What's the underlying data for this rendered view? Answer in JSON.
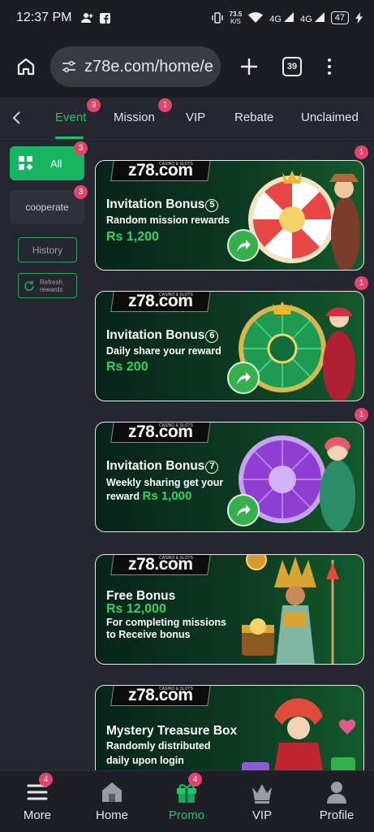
{
  "status_bar": {
    "time": "12:37 PM",
    "net_speed_value": "73.5",
    "net_speed_unit": "K/S",
    "signal1": "4G",
    "signal2": "4G",
    "battery": "47"
  },
  "browser": {
    "url": "z78e.com/home/e",
    "tab_count": "39"
  },
  "tabs": [
    {
      "label": "Event",
      "badge": "3",
      "active": true
    },
    {
      "label": "Mission",
      "badge": "1",
      "active": false
    },
    {
      "label": "VIP",
      "badge": "",
      "active": false
    },
    {
      "label": "Rebate",
      "badge": "",
      "active": false
    },
    {
      "label": "Unclaimed",
      "badge": "",
      "active": false
    }
  ],
  "sidebar": {
    "all_label": "All",
    "all_badge": "3",
    "cooperate_label": "cooperate",
    "cooperate_badge": "3",
    "history_label": "History",
    "refresh_label_1": "Refresh",
    "refresh_label_2": "rewards"
  },
  "cards": [
    {
      "logo": "z78.com",
      "logo_tag": "CASINO & SLOTS",
      "title": "Invitation Bonus",
      "num": "5",
      "line1": "Random mission rewards",
      "line2": "",
      "amount": "Rs 1,200",
      "badge": "1"
    },
    {
      "logo": "z78.com",
      "logo_tag": "CASINO & SLOTS",
      "title": "Invitation Bonus",
      "num": "6",
      "line1": "Daily share your reward",
      "line2": "",
      "amount": "Rs 200",
      "badge": "1"
    },
    {
      "logo": "z78.com",
      "logo_tag": "CASINO & SLOTS",
      "title": "Invitation Bonus",
      "num": "7",
      "line1": "Weekly sharing get your",
      "line2": "reward",
      "amount": "Rs 1,000",
      "badge": "1"
    },
    {
      "logo": "z78.com",
      "logo_tag": "CASINO & SLOTS",
      "title": "Free Bonus",
      "num": "",
      "line1": "For completing missions",
      "line2": "to Receive bonus",
      "amount": "Rs 12,000",
      "badge": ""
    },
    {
      "logo": "z78.com",
      "logo_tag": "CASINO & SLOTS",
      "title": "Mystery Treasure Box",
      "num": "",
      "line1": "Randomly distributed",
      "line2": "daily upon login",
      "amount": "",
      "badge": ""
    }
  ],
  "bottom_nav": [
    {
      "label": "More",
      "badge": "4",
      "icon": "menu-icon",
      "active": false
    },
    {
      "label": "Home",
      "badge": "",
      "icon": "home-icon",
      "active": false
    },
    {
      "label": "Promo",
      "badge": "4",
      "icon": "gift-icon",
      "active": true
    },
    {
      "label": "VIP",
      "badge": "",
      "icon": "crown-icon",
      "active": false
    },
    {
      "label": "Profile",
      "badge": "",
      "icon": "person-icon",
      "active": false
    }
  ],
  "colors": {
    "accent": "#20c36c",
    "badge": "#e2456b",
    "background": "#25262f"
  }
}
